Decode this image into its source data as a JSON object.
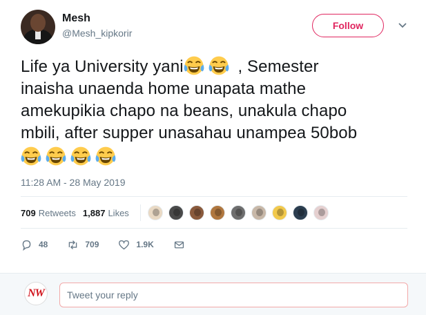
{
  "user": {
    "name": "Mesh",
    "handle": "@Mesh_kipkorir"
  },
  "follow_button": {
    "label": "Follow"
  },
  "tweet": {
    "line1_a": "Life ya University yani",
    "line1_b": " , Semester",
    "line2": "inaisha unaenda home unapata mathe",
    "line3": "amekupikia chapo na beans, unakula chapo",
    "line4": "mbili, after supper unasahau unampea 50bob",
    "emoji_name": "face-with-tears-of-joy"
  },
  "timestamp": "11:28 AM - 28 May 2019",
  "stats": {
    "retweets_count": "709",
    "retweets_label": "Retweets",
    "likes_count": "1,887",
    "likes_label": "Likes"
  },
  "likers": [
    {
      "color": "#e9d9c4"
    },
    {
      "color": "#4a4a4a"
    },
    {
      "color": "#8a5a3c"
    },
    {
      "color": "#b0773f"
    },
    {
      "color": "#6e6e6e"
    },
    {
      "color": "#c8b8a8"
    },
    {
      "color": "#f2c94c"
    },
    {
      "color": "#2c3e50"
    },
    {
      "color": "#e5d0d0"
    }
  ],
  "actions": {
    "replies": "48",
    "retweets": "709",
    "likes": "1.9K"
  },
  "reply": {
    "placeholder": "Tweet your reply",
    "logo_text": "NW"
  },
  "colors": {
    "accent": "#e0245e",
    "muted": "#657786",
    "text": "#14171a"
  }
}
